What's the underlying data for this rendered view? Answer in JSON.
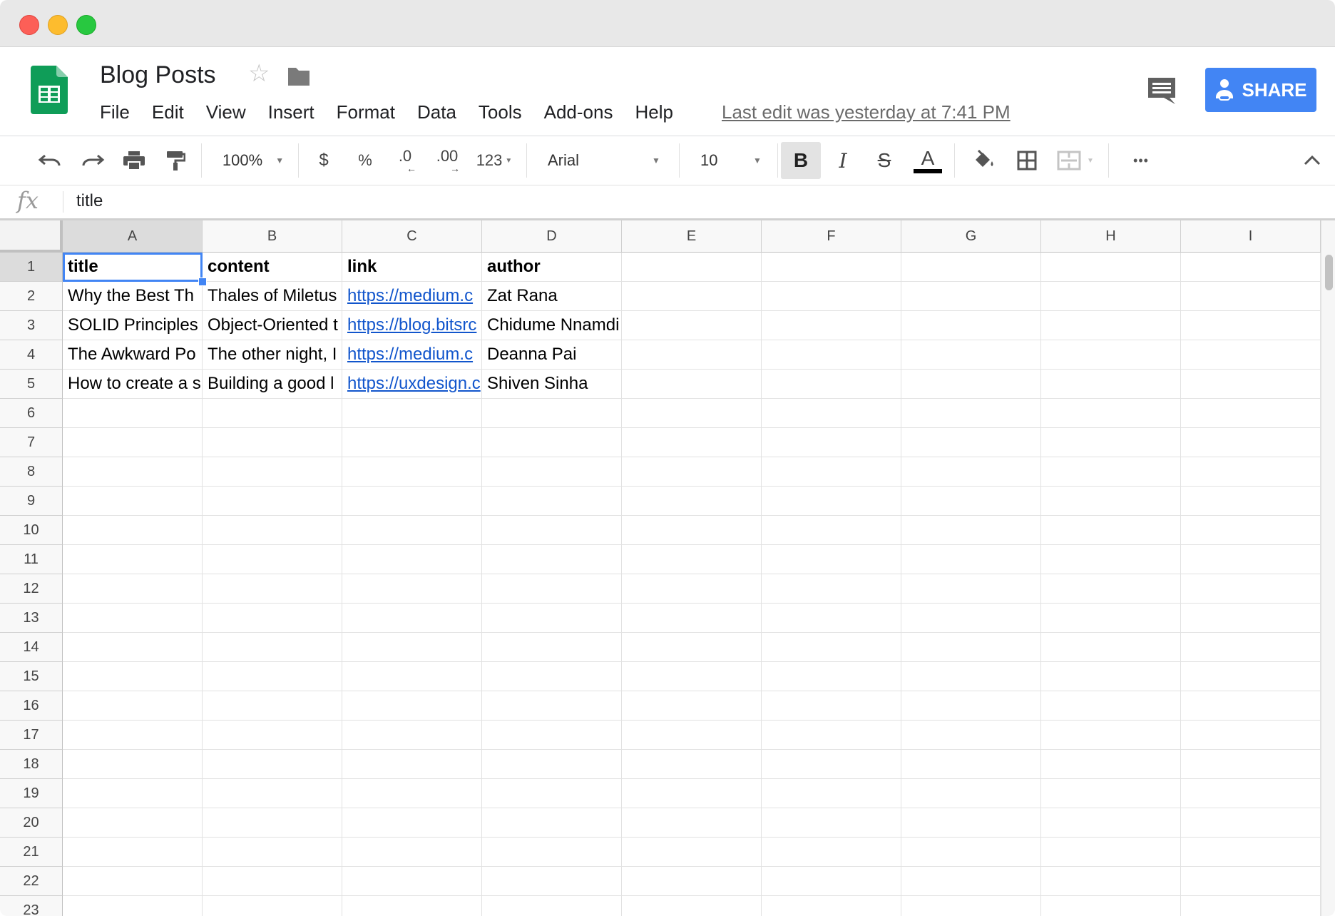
{
  "document": {
    "title": "Blog Posts",
    "last_edit": "Last edit was yesterday at 7:41 PM"
  },
  "menu": [
    "File",
    "Edit",
    "View",
    "Insert",
    "Format",
    "Data",
    "Tools",
    "Add-ons",
    "Help"
  ],
  "share_label": "SHARE",
  "toolbar": {
    "zoom": "100%",
    "currency": "$",
    "percent": "%",
    "decrease_decimal": ".0",
    "increase_decimal": ".00",
    "more_formats": "123",
    "font": "Arial",
    "font_size": "10",
    "bold": "B",
    "italic": "I",
    "strikethrough": "S",
    "text_color": "A",
    "more": "•••"
  },
  "formula_bar": {
    "fx": "fx",
    "value": "title"
  },
  "columns": [
    "A",
    "B",
    "C",
    "D",
    "E",
    "F",
    "G",
    "H",
    "I"
  ],
  "rows": [
    "1",
    "2",
    "3",
    "4",
    "5",
    "6",
    "7",
    "8",
    "9",
    "10",
    "11",
    "12",
    "13",
    "14",
    "15",
    "16",
    "17",
    "18",
    "19",
    "20",
    "21",
    "22",
    "23"
  ],
  "cells": {
    "r1": [
      "title",
      "content",
      "link",
      "author"
    ],
    "r2": [
      "Why the Best Th",
      "Thales of Miletus",
      "https://medium.c",
      "Zat Rana"
    ],
    "r3": [
      "SOLID Principles",
      "Object-Oriented t",
      "https://blog.bitsrc",
      "Chidume Nnamdi"
    ],
    "r4": [
      "The Awkward Po",
      "The other night, I",
      "https://medium.c",
      "Deanna Pai"
    ],
    "r5": [
      "How to create a s",
      "Building a good l",
      "https://uxdesign.c",
      "Shiven Sinha"
    ]
  },
  "colors": {
    "accent": "#4285f4",
    "sheets_green": "#0f9d58",
    "link": "#1155cc"
  }
}
